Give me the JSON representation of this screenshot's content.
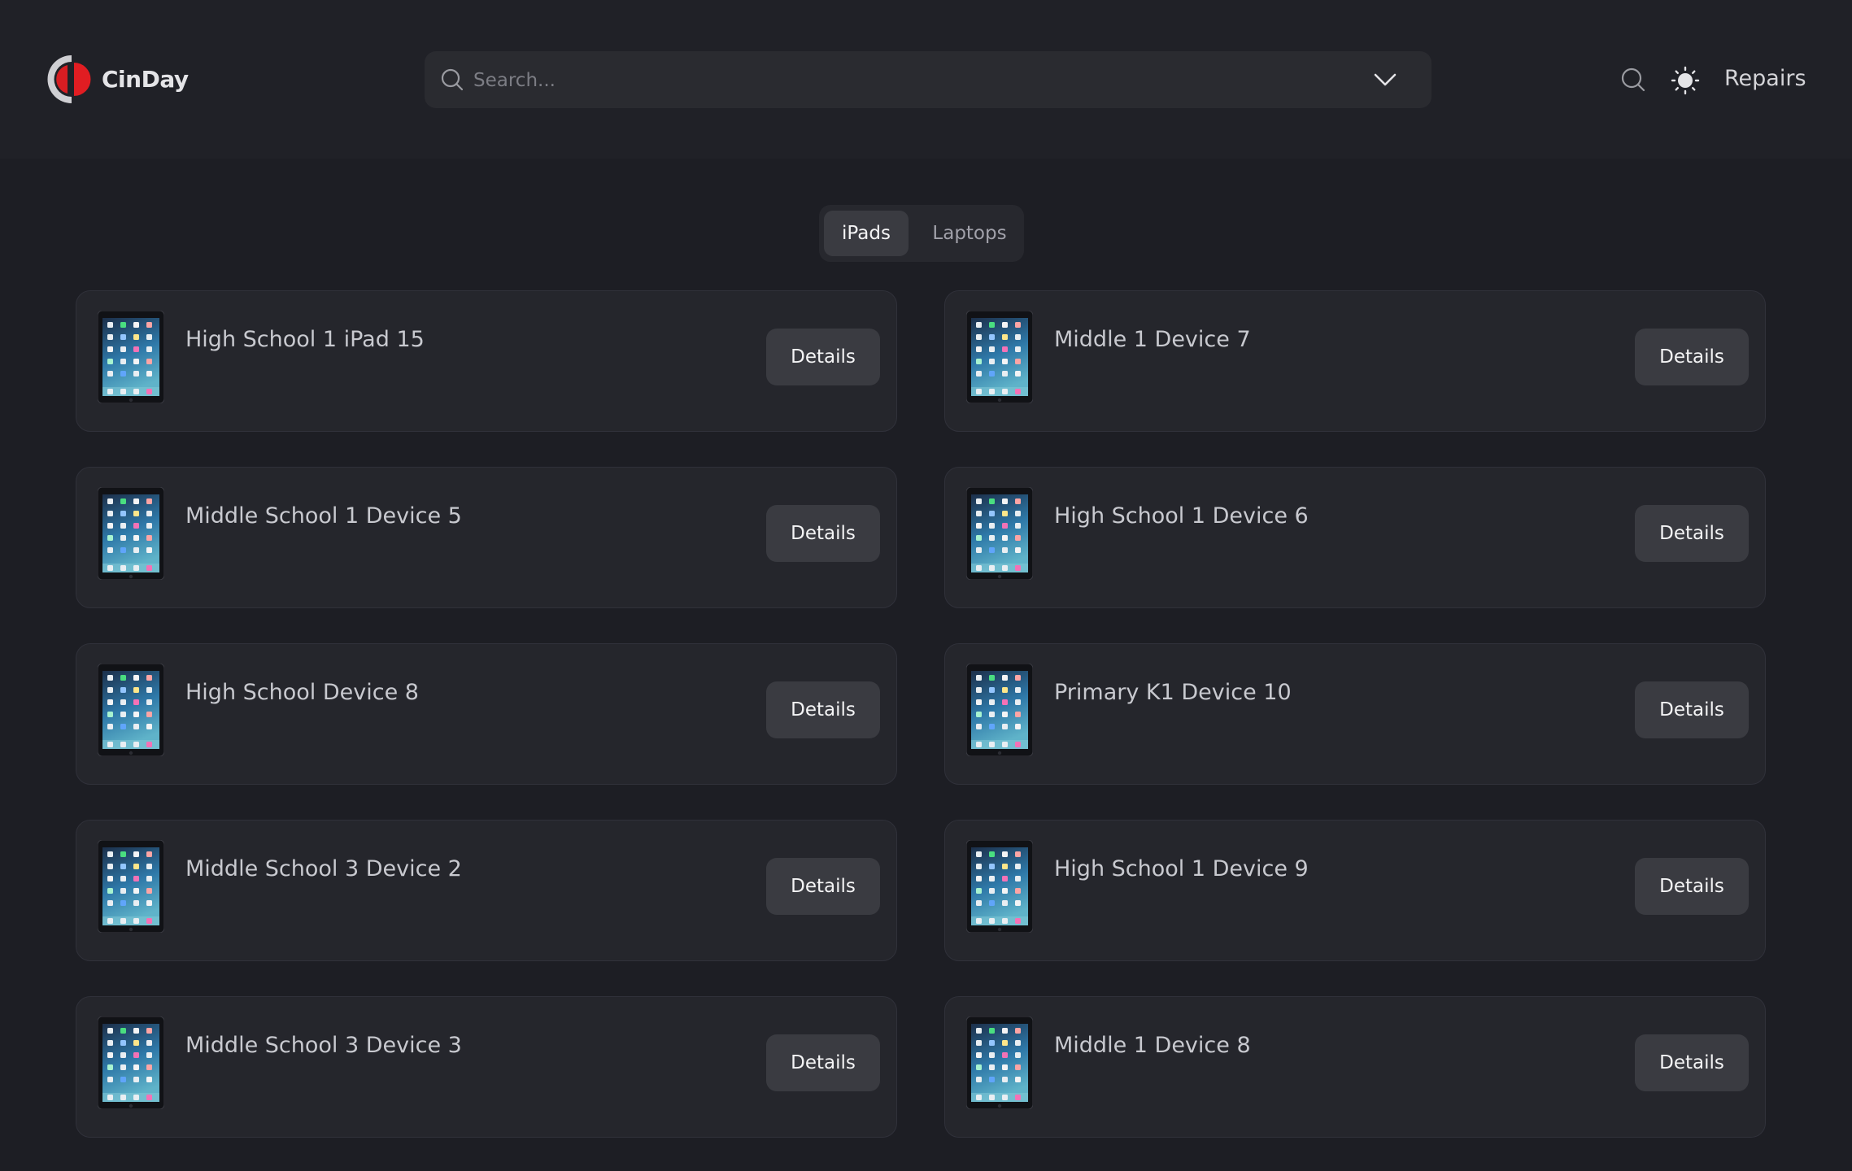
{
  "app": {
    "name": "CinDay",
    "brand_colors": {
      "accent": "#e11d22",
      "background": "#1d1e24",
      "header": "#202127",
      "card": "#25262c"
    }
  },
  "header": {
    "search_placeholder": "Search...",
    "repairs_label": "Repairs",
    "icons": [
      "search-icon",
      "chevron-down-icon",
      "search-icon",
      "sun-icon"
    ]
  },
  "tabs": [
    {
      "label": "iPads",
      "active": true
    },
    {
      "label": "Laptops",
      "active": false
    }
  ],
  "devices": [
    {
      "name": "High School 1 iPad 15",
      "button": "Details"
    },
    {
      "name": "Middle 1 Device 7",
      "button": "Details"
    },
    {
      "name": "Middle School 1 Device 5",
      "button": "Details"
    },
    {
      "name": "High School 1 Device 6",
      "button": "Details"
    },
    {
      "name": "High School Device 8",
      "button": "Details"
    },
    {
      "name": "Primary K1 Device 10",
      "button": "Details"
    },
    {
      "name": "Middle School 3 Device 2",
      "button": "Details"
    },
    {
      "name": "High School 1 Device 9",
      "button": "Details"
    },
    {
      "name": "Middle School 3 Device 3",
      "button": "Details"
    },
    {
      "name": "Middle 1 Device 8",
      "button": "Details"
    }
  ]
}
